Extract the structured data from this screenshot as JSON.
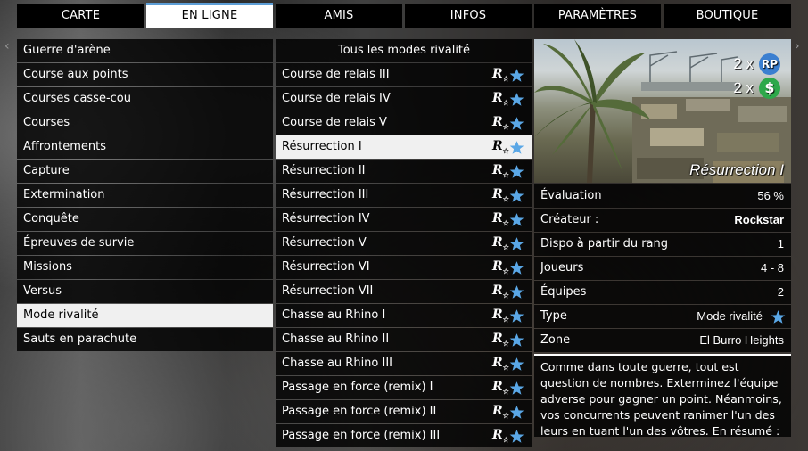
{
  "nav": {
    "left_arrow": "‹",
    "right_arrow": "›",
    "tabs": [
      "CARTE",
      "EN LIGNE",
      "AMIS",
      "INFOS",
      "PARAMÈTRES",
      "BOUTIQUE"
    ],
    "active_tab": "EN LIGNE"
  },
  "categories": [
    "Guerre d'arène",
    "Course aux points",
    "Courses casse-cou",
    "Courses",
    "Affrontements",
    "Capture",
    "Extermination",
    "Conquête",
    "Épreuves de survie",
    "Missions",
    "Versus",
    "Mode rivalité",
    "Sauts en parachute"
  ],
  "selected_category": "Mode rivalité",
  "jobs": {
    "header": "Tous les modes rivalité",
    "rockstar_mark": "R",
    "rockstar_mark_sub": "☆",
    "items": [
      "Course de relais III",
      "Course de relais IV",
      "Course de relais V",
      "Résurrection I",
      "Résurrection II",
      "Résurrection III",
      "Résurrection IV",
      "Résurrection V",
      "Résurrection VI",
      "Résurrection VII",
      "Chasse au Rhino I",
      "Chasse au Rhino II",
      "Chasse au Rhino III",
      "Passage en force (remix) I",
      "Passage en force (remix) II",
      "Passage en force (remix) III"
    ],
    "selected": "Résurrection I"
  },
  "details": {
    "preview_title": "Résurrection I",
    "rp_multiplier": "2 x",
    "rp_label": "RP",
    "cash_multiplier": "2 x",
    "cash_label": "$",
    "rows": [
      {
        "label": "Évaluation",
        "value": "56 %"
      },
      {
        "label": "Créateur :",
        "value": "Rockstar"
      },
      {
        "label": "Dispo à partir du rang",
        "value": "1"
      },
      {
        "label": "Joueurs",
        "value": "4 - 8"
      },
      {
        "label": "Équipes",
        "value": "2"
      },
      {
        "label": "Type",
        "value": "Mode rivalité"
      },
      {
        "label": "Zone",
        "value": "El Burro Heights"
      }
    ],
    "description": "Comme dans toute guerre, tout est question de nombres. Exterminez l'équipe adverse pour gagner un point. Néanmoins, vos concurrents peuvent ranimer l'un des leurs en tuant l'un des vôtres. En résumé : ..."
  },
  "colors": {
    "accent": "#5d9ed6",
    "star": "#5aa7e6",
    "rp_badge": "#3b7fd0",
    "cash_badge": "#2da84a"
  },
  "icons": {
    "verified": "star-icon",
    "creator": "rockstar-logo-icon"
  }
}
